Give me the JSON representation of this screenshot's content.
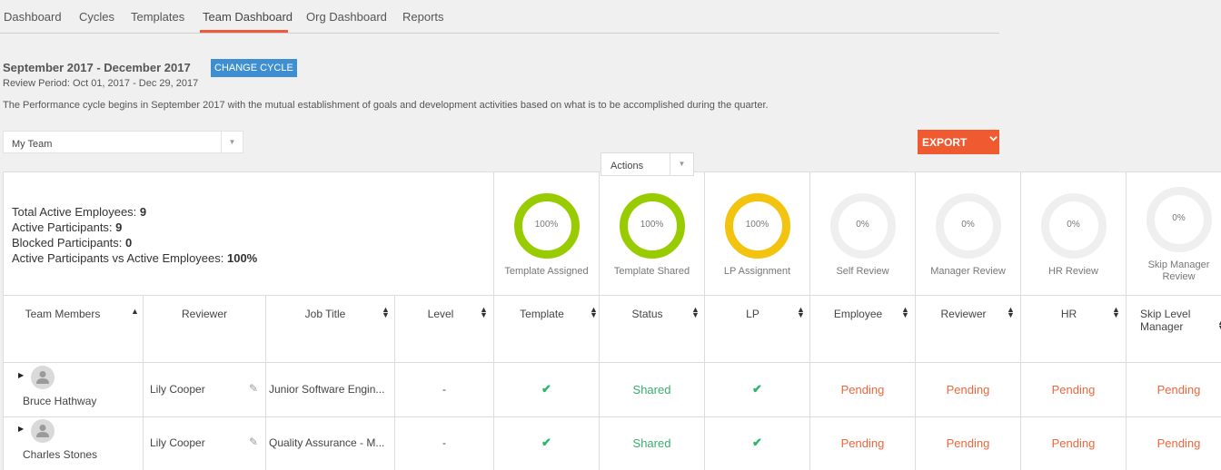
{
  "nav": {
    "tabs": [
      {
        "label": "Dashboard"
      },
      {
        "label": "Cycles"
      },
      {
        "label": "Templates"
      },
      {
        "label": "Team Dashboard",
        "active": true
      },
      {
        "label": "Org Dashboard"
      },
      {
        "label": "Reports"
      }
    ]
  },
  "cycle": {
    "title": "September 2017 - December 2017",
    "change_label": "CHANGE CYCLE",
    "review_period": "Review Period: Oct 01, 2017 - Dec 29, 2017",
    "description": "The Performance cycle begins in September 2017 with the mutual establishment of goals and development activities based on what is to be accomplished during the quarter."
  },
  "team_select": {
    "value": "My Team"
  },
  "export": {
    "label": "EXPORT"
  },
  "summary": {
    "total_active_label": "Total Active Employees: ",
    "total_active_value": "9",
    "active_participants_label": "Active Participants: ",
    "active_participants_value": "9",
    "blocked_label": "Blocked Participants: ",
    "blocked_value": "0",
    "ratio_label": "Active Participants vs Active Employees: ",
    "ratio_value": "100%"
  },
  "kpis": [
    {
      "pct": "100%",
      "label": "Template Assigned",
      "color": "#99cc00"
    },
    {
      "pct": "100%",
      "label": "Template Shared",
      "color": "#99cc00"
    },
    {
      "pct": "100%",
      "label": "LP Assignment",
      "color": "#f2c30f"
    },
    {
      "pct": "0%",
      "label": "Self Review",
      "color": "#efefef"
    },
    {
      "pct": "0%",
      "label": "Manager Review",
      "color": "#efefef"
    },
    {
      "pct": "0%",
      "label": "HR Review",
      "color": "#efefef"
    },
    {
      "pct": "0%",
      "label": "Skip Manager Review",
      "color": "#efefef"
    }
  ],
  "columns": {
    "team_members": "Team Members",
    "reviewer": "Reviewer",
    "job_title": "Job Title",
    "level": "Level",
    "template": "Template",
    "status": "Status",
    "lp": "LP",
    "employee": "Employee",
    "reviewer2": "Reviewer",
    "hr": "HR",
    "skip_level": "Skip Level Manager"
  },
  "actions_select": {
    "value": "Actions"
  },
  "rows": [
    {
      "name": "Bruce Hathway",
      "reviewer": "Lily Cooper",
      "job_title": "Junior Software Engin...",
      "level": "-",
      "template": "✔",
      "status": "Shared",
      "lp": "✔",
      "employee": "Pending",
      "reviewer_status": "Pending",
      "hr": "Pending",
      "skip": "Pending"
    },
    {
      "name": "Charles Stones",
      "reviewer": "Lily Cooper",
      "job_title": "Quality Assurance - M...",
      "level": "-",
      "template": "✔",
      "status": "Shared",
      "lp": "✔",
      "employee": "Pending",
      "reviewer_status": "Pending",
      "hr": "Pending",
      "skip": "Pending"
    }
  ]
}
